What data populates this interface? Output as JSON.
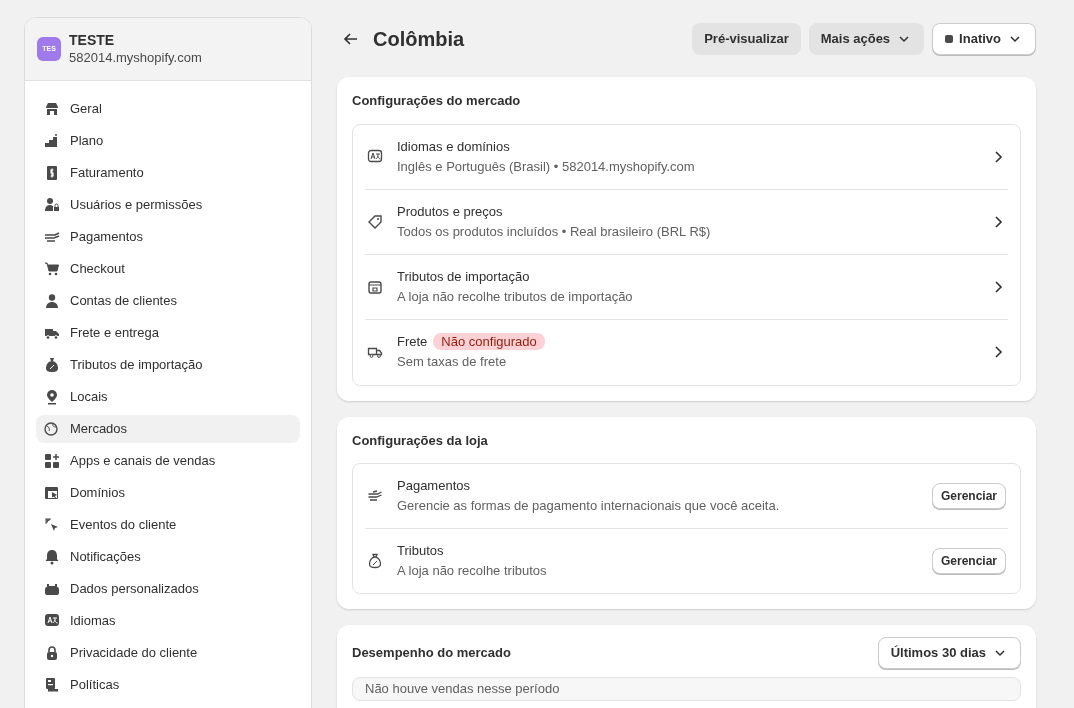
{
  "store": {
    "avatar": "TES",
    "name": "TESTE",
    "domain": "582014.myshopify.com"
  },
  "sidebar": {
    "items": [
      {
        "label": "Geral",
        "selected": false
      },
      {
        "label": "Plano",
        "selected": false
      },
      {
        "label": "Faturamento",
        "selected": false
      },
      {
        "label": "Usuários e permissões",
        "selected": false
      },
      {
        "label": "Pagamentos",
        "selected": false
      },
      {
        "label": "Checkout",
        "selected": false
      },
      {
        "label": "Contas de clientes",
        "selected": false
      },
      {
        "label": "Frete e entrega",
        "selected": false
      },
      {
        "label": "Tributos de importação",
        "selected": false
      },
      {
        "label": "Locais",
        "selected": false
      },
      {
        "label": "Mercados",
        "selected": true
      },
      {
        "label": "Apps e canais de vendas",
        "selected": false
      },
      {
        "label": "Domínios",
        "selected": false
      },
      {
        "label": "Eventos do cliente",
        "selected": false
      },
      {
        "label": "Notificações",
        "selected": false
      },
      {
        "label": "Dados personalizados",
        "selected": false
      },
      {
        "label": "Idiomas",
        "selected": false
      },
      {
        "label": "Privacidade do cliente",
        "selected": false
      },
      {
        "label": "Políticas",
        "selected": false
      }
    ]
  },
  "page": {
    "title": "Colômbia",
    "actions": [
      "Pré-visualizar",
      "Mais ações"
    ],
    "status": "Inativo"
  },
  "market_settings": {
    "title": "Configurações do mercado",
    "rows": [
      {
        "title": "Idiomas e domínios",
        "subtitle": "Inglês e Português (Brasil) • 582014.myshopify.com"
      },
      {
        "title": "Produtos e preços",
        "subtitle": "Todos os produtos incluídos • Real brasileiro (BRL R$)"
      },
      {
        "title": "Tributos de importação",
        "subtitle": "A loja não recolhe tributos de importação"
      },
      {
        "title": "Frete",
        "badge": "Não configurado",
        "subtitle": "Sem taxas de frete"
      }
    ]
  },
  "store_settings": {
    "title": "Configurações da loja",
    "rows": [
      {
        "title": "Pagamentos",
        "subtitle": "Gerencie as formas de pagamento internacionais que você aceita.",
        "button": "Gerenciar"
      },
      {
        "title": "Tributos",
        "subtitle": "A loja não recolhe tributos",
        "button": "Gerenciar"
      }
    ]
  },
  "performance": {
    "title": "Desempenho do mercado",
    "period": "Últimos 30 dias",
    "empty": "Não houve vendas nesse período"
  }
}
